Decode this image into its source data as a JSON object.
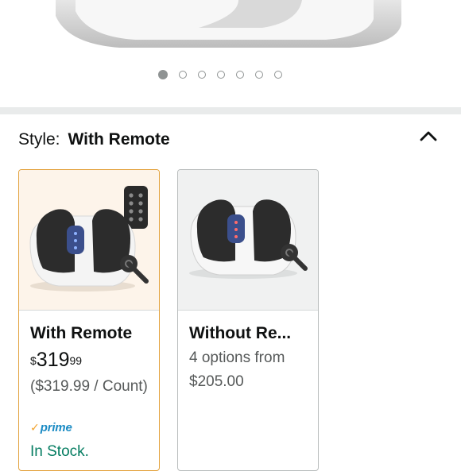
{
  "carousel": {
    "image_count": 7,
    "active_index": 0
  },
  "style_selector": {
    "label": "Style:",
    "selected_value": "With Remote",
    "collapse_icon": "chevron-up-icon"
  },
  "options": [
    {
      "name": "With Remote",
      "price_symbol": "$",
      "price_whole": "319",
      "price_fraction": "99",
      "unit_price": "($319.99 / Count)",
      "prime_label": "prime",
      "stock": "In Stock.",
      "selected": true
    },
    {
      "name": "Without Re...",
      "options_text": "4 options from",
      "options_price": "$205.00",
      "selected": false
    }
  ],
  "colors": {
    "selected_border": "#e3a23d",
    "unselected_border": "#b9bdbd",
    "in_stock": "#067d62",
    "prime_blue": "#1b8bc4",
    "prime_check": "#f2a22c",
    "muted_text": "#565959"
  }
}
